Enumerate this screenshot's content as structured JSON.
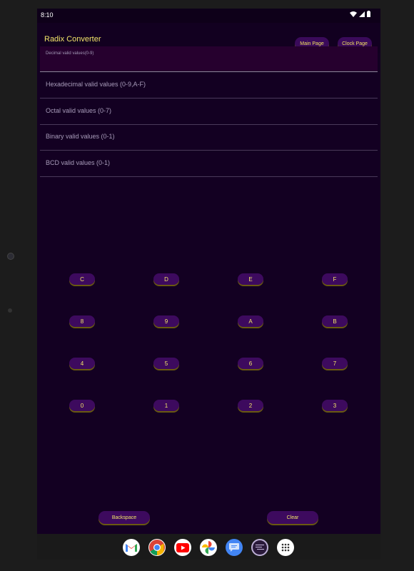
{
  "status": {
    "time": "8:10"
  },
  "app": {
    "title": "Radix Converter"
  },
  "nav": {
    "main_page": "Main Page",
    "clock_page": "Clock Page"
  },
  "fields": {
    "decimal": "Decimal valid values(0-9)",
    "hexadecimal": "Hexadecimal valid values (0-9,A-F)",
    "octal": "Octal valid values (0-7)",
    "binary": "Binary valid values (0-1)",
    "bcd": "BCD valid values  (0-1)"
  },
  "keypad": {
    "rows": [
      [
        "C",
        "D",
        "E",
        "F"
      ],
      [
        "8",
        "9",
        "A",
        "B"
      ],
      [
        "4",
        "5",
        "6",
        "7"
      ],
      [
        "0",
        "1",
        "2",
        "3"
      ]
    ]
  },
  "actions": {
    "backspace": "Backspace",
    "clear": "Clear"
  },
  "dock": {
    "apps": [
      "gmail-icon",
      "chrome-icon",
      "youtube-icon",
      "photos-icon",
      "messages-icon",
      "radix-app-icon",
      "app-drawer-icon"
    ]
  },
  "colors": {
    "background": "#130022",
    "accent_text": "#f2e56a",
    "button": "#3d0a5e",
    "button_shadow": "#6a5a10"
  }
}
